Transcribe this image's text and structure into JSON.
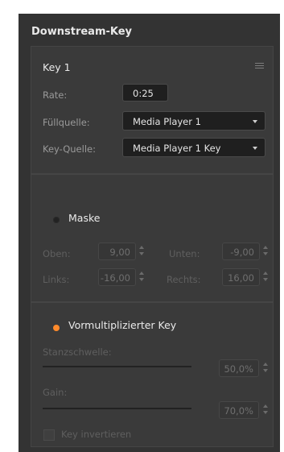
{
  "panel": {
    "title": "Downstream-Key"
  },
  "key": {
    "name": "Key 1",
    "rate_label": "Rate:",
    "rate_value": "0:25",
    "fill_label": "Füllquelle:",
    "fill_value": "Media Player 1",
    "keysrc_label": "Key-Quelle:",
    "keysrc_value": "Media Player 1 Key"
  },
  "mask": {
    "label": "Maske",
    "enabled": false,
    "top_label": "Oben:",
    "top_value": "9,00",
    "bottom_label": "Unten:",
    "bottom_value": "-9,00",
    "left_label": "Links:",
    "left_value": "-16,00",
    "right_label": "Rechts:",
    "right_value": "16,00"
  },
  "premult": {
    "label": "Vormultiplizierter Key",
    "enabled": true,
    "threshold_label": "Stanzschwelle:",
    "threshold_value": "50,0%",
    "gain_label": "Gain:",
    "gain_value": "70,0%",
    "invert_label": "Key invertieren",
    "invert_checked": false
  },
  "colors": {
    "accent": "#ff8a2b",
    "panel_bg": "#333333",
    "section_bg": "#3a3a3a"
  }
}
